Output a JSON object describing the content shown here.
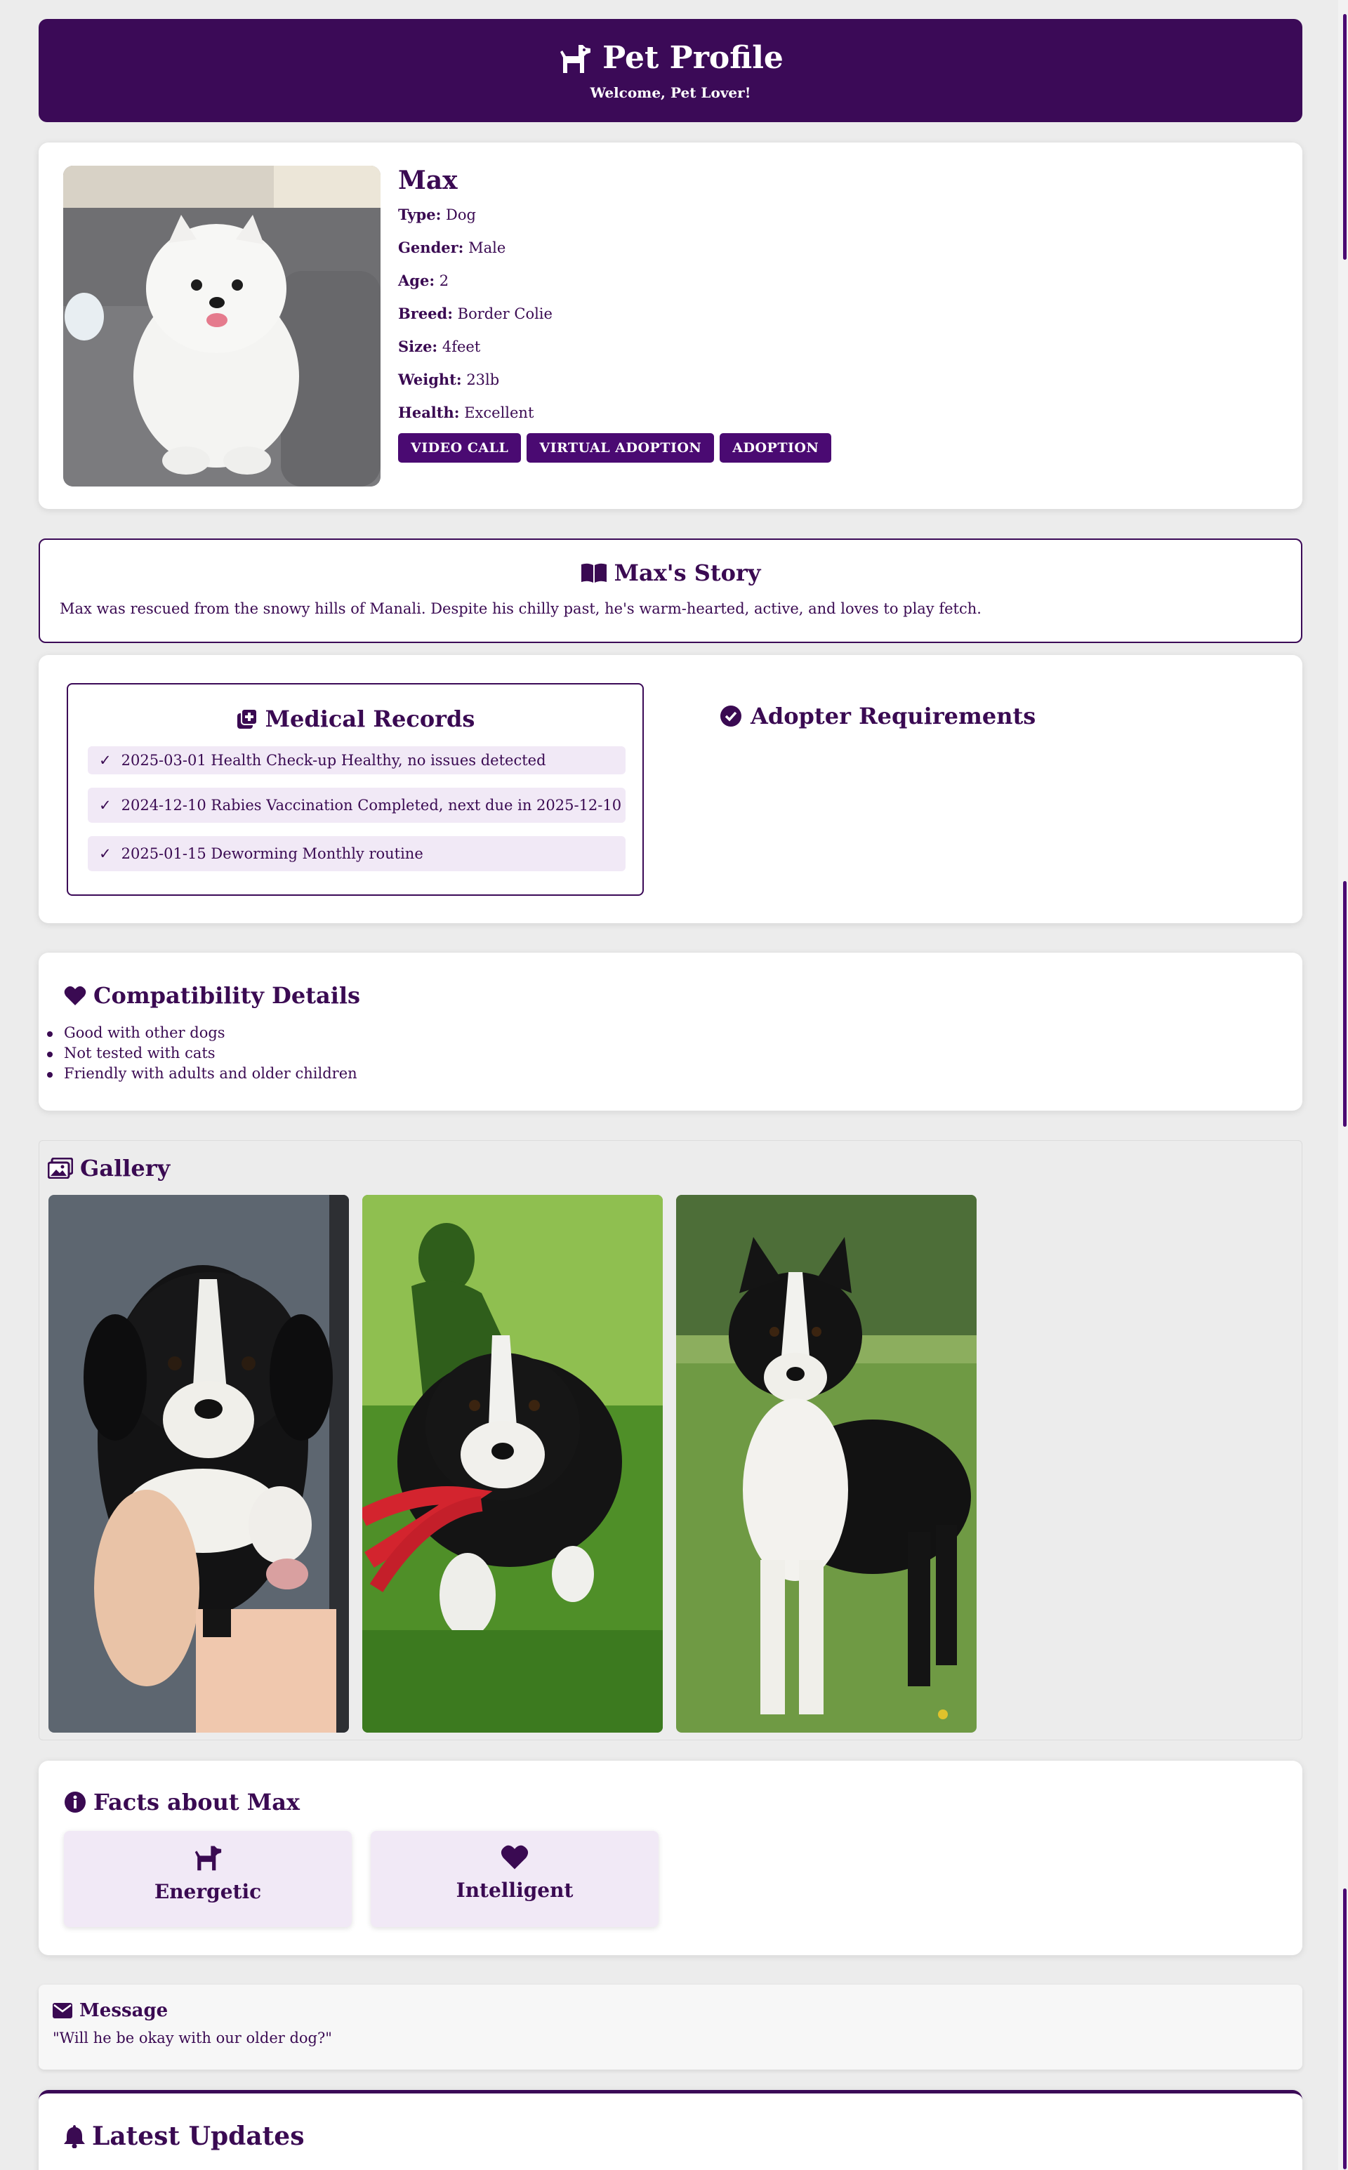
{
  "header": {
    "title": "Pet Profile",
    "subtitle": "Welcome, Pet Lover!"
  },
  "pet": {
    "name": "Max",
    "fields": [
      {
        "label": "Type:",
        "value": "Dog"
      },
      {
        "label": "Gender:",
        "value": "Male"
      },
      {
        "label": "Age:",
        "value": "2"
      },
      {
        "label": "Breed:",
        "value": "Border Colie"
      },
      {
        "label": "Size:",
        "value": "4feet"
      },
      {
        "label": "Weight:",
        "value": "23lb"
      },
      {
        "label": "Health:",
        "value": "Excellent"
      }
    ],
    "buttons": [
      "VIDEO CALL",
      "VIRTUAL ADOPTION",
      "ADOPTION"
    ]
  },
  "story": {
    "title": "Max's Story",
    "text": "Max was rescued from the snowy hills of Manali. Despite his chilly past, he's warm-hearted, active, and loves to play fetch."
  },
  "medical": {
    "title": "Medical Records",
    "records": [
      "2025-03-01 Health Check-up Healthy, no issues detected",
      "2024-12-10 Rabies Vaccination Completed, next due in 2025-12-10",
      "2025-01-15 Deworming Monthly routine"
    ]
  },
  "adopter": {
    "title": "Adopter Requirements"
  },
  "compatibility": {
    "title": "Compatibility Details",
    "items": [
      "Good with other dogs",
      "Not tested with cats",
      "Friendly with adults and older children"
    ]
  },
  "gallery": {
    "title": "Gallery"
  },
  "facts": {
    "title": "Facts about Max",
    "items": [
      {
        "label": "Energetic",
        "icon": "dog-icon"
      },
      {
        "label": "Intelligent",
        "icon": "heart-icon"
      }
    ]
  },
  "message": {
    "title": "Message",
    "text": "\"Will he be okay with our older dog?\""
  },
  "updates": {
    "title": "Latest Updates"
  },
  "colors": {
    "primary": "#3b0a57",
    "accent": "#4a0a72",
    "tint": "#f1e9f6",
    "background": "#ececec"
  }
}
